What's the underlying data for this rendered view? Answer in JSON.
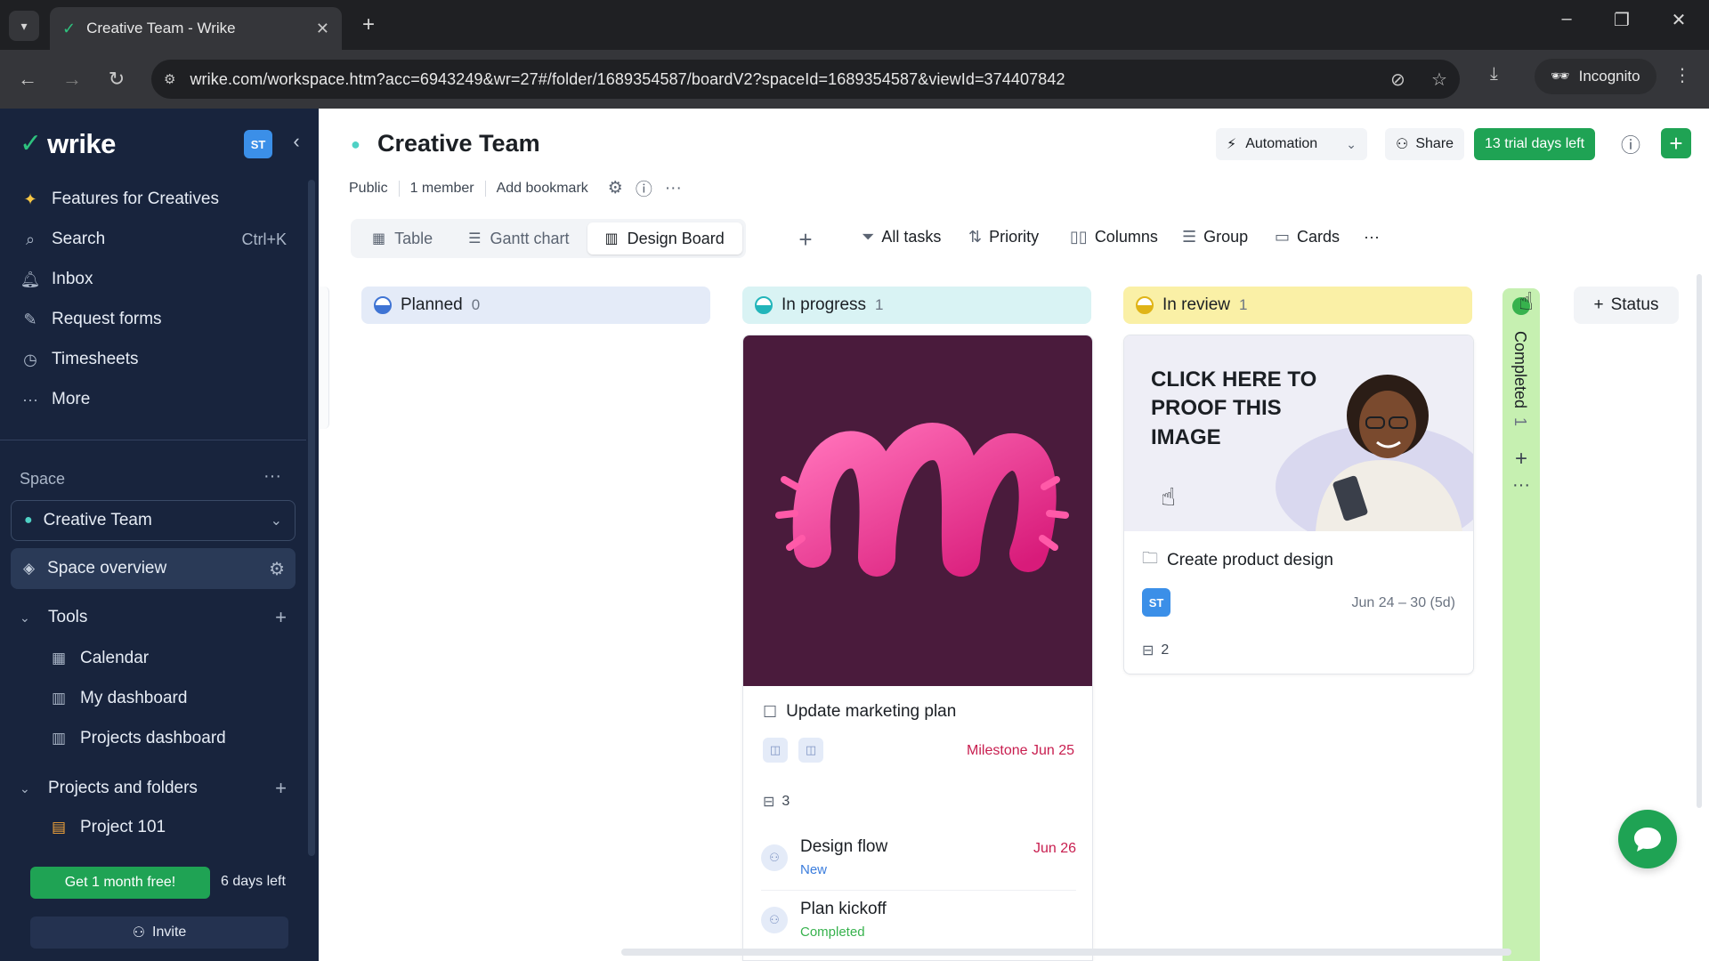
{
  "browser": {
    "tab_title": "Creative Team - Wrike",
    "url": "wrike.com/workspace.htm?acc=6943249&wr=27#/folder/1689354587/boardV2?spaceId=1689354587&viewId=374407842",
    "incognito_label": "Incognito"
  },
  "sidebar": {
    "logo": "wrike",
    "user_initials": "ST",
    "nav": [
      {
        "label": "Features for Creatives",
        "icon": "sparkle-icon"
      },
      {
        "label": "Search",
        "icon": "search-icon",
        "shortcut": "Ctrl+K"
      },
      {
        "label": "Inbox",
        "icon": "bell-icon"
      },
      {
        "label": "Request forms",
        "icon": "form-icon"
      },
      {
        "label": "Timesheets",
        "icon": "clock-icon"
      },
      {
        "label": "More",
        "icon": "more-icon"
      }
    ],
    "space_label": "Space",
    "space_name": "Creative Team",
    "space_overview": "Space overview",
    "tools_label": "Tools",
    "tools": [
      {
        "label": "Calendar",
        "icon": "calendar-icon"
      },
      {
        "label": "My dashboard",
        "icon": "dashboard-icon"
      },
      {
        "label": "Projects dashboard",
        "icon": "dashboard-icon"
      }
    ],
    "projects_label": "Projects and folders",
    "projects": [
      {
        "label": "Project 101",
        "icon": "project-icon"
      }
    ],
    "promo_label": "Get 1 month free!",
    "days_left": "6 days left",
    "invite_label": "Invite"
  },
  "header": {
    "title": "Creative Team",
    "visibility": "Public",
    "members": "1 member",
    "bookmark": "Add bookmark",
    "automation_label": "Automation",
    "share_label": "Share",
    "trial_label": "13 trial days left"
  },
  "views": {
    "tabs": [
      {
        "label": "Table",
        "icon": "table-icon",
        "active": false
      },
      {
        "label": "Gantt chart",
        "icon": "gantt-icon",
        "active": false
      },
      {
        "label": "Design Board",
        "icon": "board-icon",
        "active": true
      }
    ],
    "tools": [
      {
        "label": "All tasks",
        "icon": "filter-icon"
      },
      {
        "label": "Priority",
        "icon": "sort-icon"
      },
      {
        "label": "Columns",
        "icon": "columns-icon"
      },
      {
        "label": "Group",
        "icon": "group-icon"
      },
      {
        "label": "Cards",
        "icon": "cards-icon"
      }
    ]
  },
  "board": {
    "columns": [
      {
        "name": "Planned",
        "count": "0",
        "color": "#3f74d4"
      },
      {
        "name": "In progress",
        "count": "1",
        "color": "#22b5ba"
      },
      {
        "name": "In review",
        "count": "1",
        "color": "#e0b417"
      }
    ],
    "completed": {
      "name": "Completed",
      "count": "1",
      "color": "#37b24d"
    },
    "add_status_label": "Status",
    "marketing_card": {
      "title": "Update marketing plan",
      "milestone": "Milestone Jun 25",
      "subtask_count": "3",
      "subtasks": [
        {
          "title": "Design flow",
          "status": "New",
          "status_color": "#3b7ddd",
          "date": "Jun 26"
        },
        {
          "title": "Plan kickoff",
          "status": "Completed",
          "status_color": "#37b24d",
          "date": ""
        }
      ]
    },
    "product_card": {
      "cover_text": "CLICK HERE TO PROOF THIS IMAGE",
      "title": "Create product design",
      "assignee": "ST",
      "dates": "Jun 24 – 30 (5d)",
      "subtask_count": "2"
    }
  }
}
